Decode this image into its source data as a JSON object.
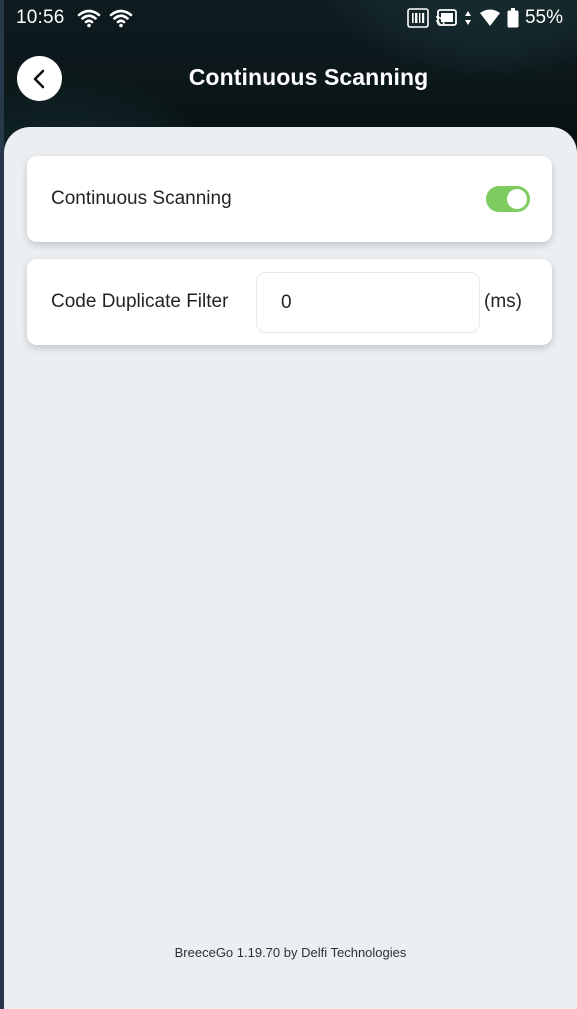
{
  "status_bar": {
    "time": "10:56",
    "battery_percent": "55%",
    "icons": [
      "wifi-icon",
      "wifi-icon",
      "barcode-icon",
      "cast-icon",
      "signal-icon",
      "wifi-filled-icon",
      "battery-icon"
    ]
  },
  "header": {
    "title": "Continuous Scanning",
    "back_icon": "chevron-left-icon"
  },
  "settings": {
    "continuous_scanning": {
      "label": "Continuous Scanning",
      "enabled": true
    },
    "duplicate_filter": {
      "label": "Code Duplicate Filter",
      "value": "0",
      "unit": "(ms)"
    }
  },
  "footer": {
    "text": "BreeceGo 1.19.70 by Delfi Technologies"
  },
  "colors": {
    "header_bg": "#0b1618",
    "content_bg": "#eceff2",
    "toggle_on": "#7ecb5f",
    "card_bg": "#ffffff"
  }
}
